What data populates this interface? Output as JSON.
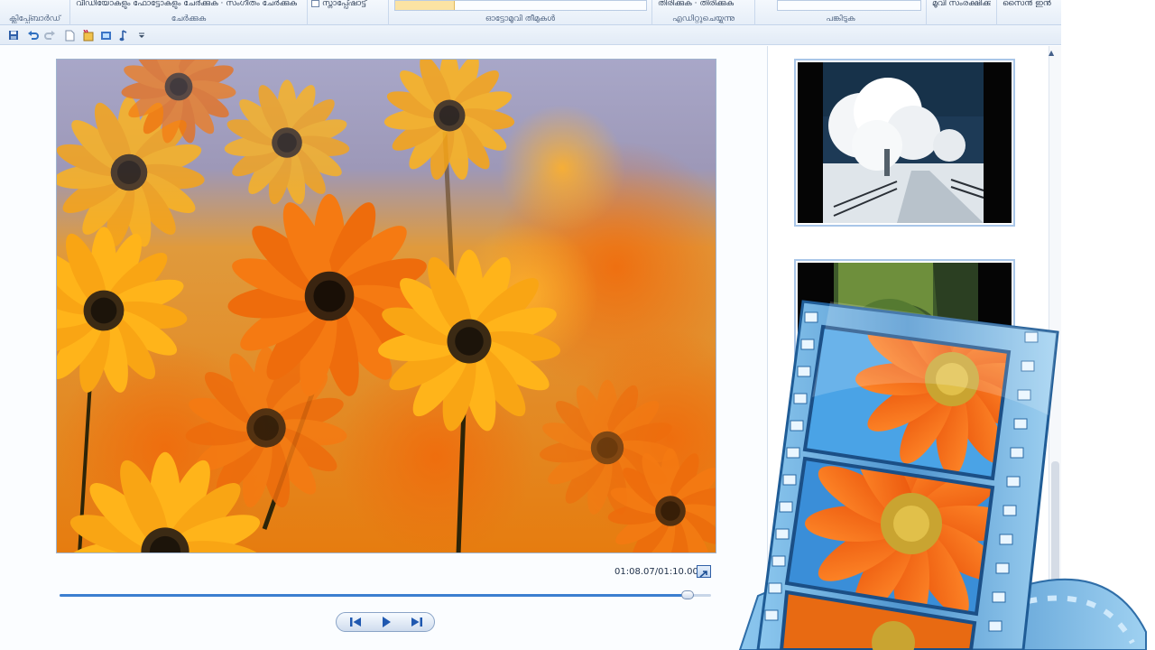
{
  "ribbon": {
    "groups": [
      {
        "label": "ക്ലിപ്പ്ബോർഡ്",
        "buttons": ""
      },
      {
        "label": "ചേർക്കുക",
        "buttons": "വീഡിയോകളും ഫോട്ടോകളും ചേർക്കുക · സംഗീതം ചേർക്കുക"
      },
      {
        "label": "",
        "buttons": "സ്നാപ്പ്ഷോട്ട്"
      },
      {
        "label": "ഓട്ടോമൂവി തീമുകൾ",
        "buttons": ""
      },
      {
        "label": "എഡിറ്റുചെയ്യുന്നു",
        "buttons": "തിരിക്കുക · തിരിക്കുക"
      },
      {
        "label": "പങ്കിടുക",
        "buttons": ""
      },
      {
        "label": "",
        "buttons": "മൂവി സംരക്ഷിക്കുക"
      },
      {
        "label": "",
        "buttons": "സൈൻ ഇൻ"
      }
    ]
  },
  "quick_access": {
    "icons": [
      "save-icon",
      "undo-icon",
      "redo-icon",
      "new-project-icon",
      "add-media-icon",
      "snapshot-icon",
      "music-icon",
      "customize-dropdown-icon"
    ]
  },
  "preview": {
    "time_label": "01:08.07/01:10.00",
    "progress": 0.973
  },
  "transport": {
    "buttons": [
      "previous-frame",
      "play",
      "next-frame"
    ]
  },
  "storyboard": {
    "clips": [
      "snowy-tree-photo",
      "garden-hedge-photo"
    ]
  },
  "colors": {
    "ribbon_bg": "#e6eef8",
    "accent": "#3c7fd0",
    "flower_orange": "#f08a12",
    "film_blue": "#5aa0d8"
  }
}
